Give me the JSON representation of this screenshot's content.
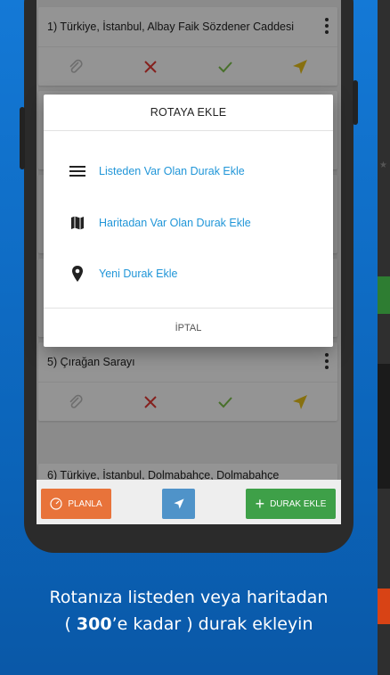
{
  "cards": [
    {
      "title": "1) Türkiye, İstanbul, Albay Faik Sözdener Caddesi"
    },
    {
      "title": "5) Çırağan Sarayı"
    },
    {
      "title": "6) Türkiye, İstanbul, Dolmabahçe, Dolmabahçe"
    }
  ],
  "dialog": {
    "title": "ROTAYA EKLE",
    "options": [
      {
        "label": "Listeden Var Olan Durak Ekle",
        "icon": "list-icon"
      },
      {
        "label": "Haritadan Var Olan Durak Ekle",
        "icon": "map-icon"
      },
      {
        "label": "Yeni Durak Ekle",
        "icon": "location-pin-icon"
      }
    ],
    "cancel": "İPTAL",
    "accent": "#2196d8"
  },
  "bottombar": {
    "planla": "PLANLA",
    "durak_ekle": "DURAK EKLE",
    "planla_color": "#e8733a",
    "nav_color": "#4f93c9",
    "durak_color": "#3ea048"
  },
  "caption": {
    "line1": "Rotanıza listeden veya haritadan",
    "line2_prefix": "( ",
    "line2_bold": "300",
    "line2_suffix": "’e kadar ) durak ekleyin"
  }
}
